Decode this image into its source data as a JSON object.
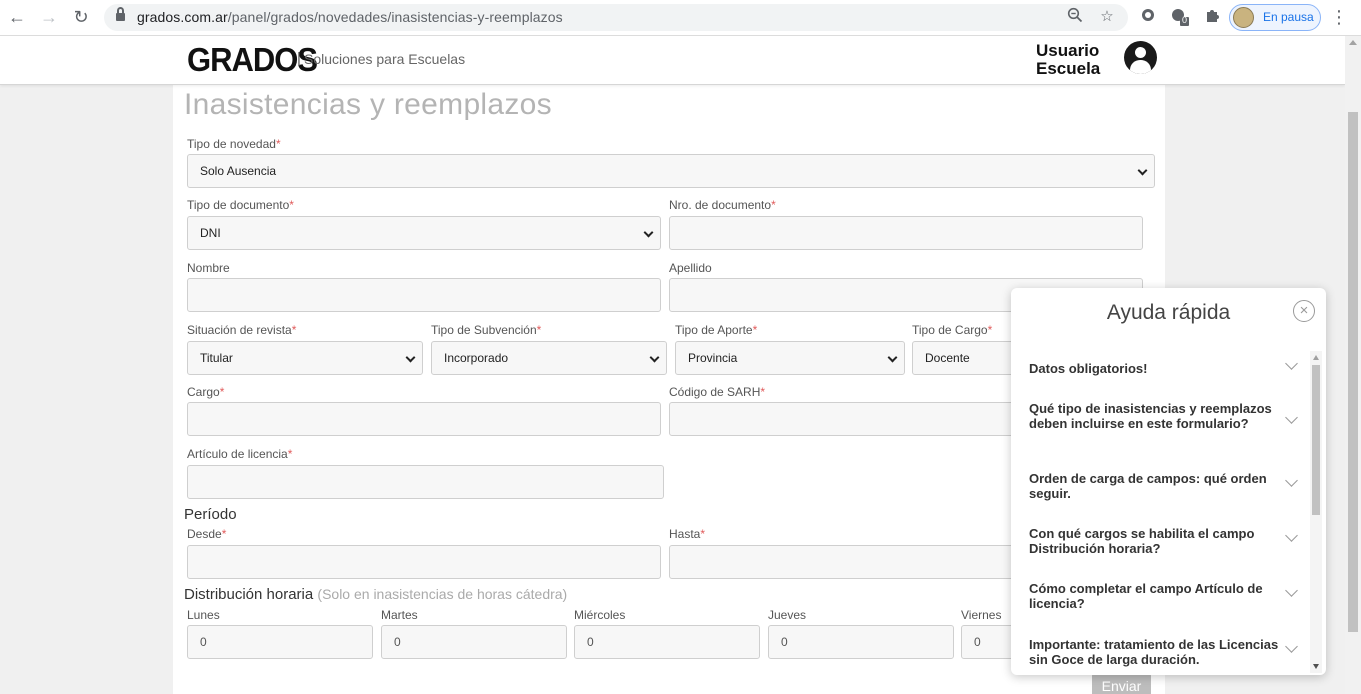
{
  "browser": {
    "url_host": "grados.com.ar",
    "url_path": "/panel/grados/novedades/inasistencias-y-reemplazos",
    "profile_label": "En pausa",
    "badge_count": "0"
  },
  "header": {
    "logo": "GRADOS",
    "separator": "|",
    "tagline": "Soluciones para Escuelas",
    "user_line1": "Usuario",
    "user_line2": "Escuela"
  },
  "form": {
    "title": "Inasistencias y reemplazos",
    "required_mark": "*",
    "tipo_novedad": {
      "label": "Tipo de novedad",
      "value": "Solo Ausencia"
    },
    "tipo_documento": {
      "label": "Tipo de documento",
      "value": "DNI"
    },
    "nro_documento": {
      "label": "Nro. de documento",
      "value": ""
    },
    "nombre": {
      "label": "Nombre",
      "value": ""
    },
    "apellido": {
      "label": "Apellido",
      "value": ""
    },
    "situacion_revista": {
      "label": "Situación de revista",
      "value": "Titular"
    },
    "tipo_subvencion": {
      "label": "Tipo de Subvención",
      "value": "Incorporado"
    },
    "tipo_aporte": {
      "label": "Tipo de Aporte",
      "value": "Provincia"
    },
    "tipo_cargo": {
      "label": "Tipo de Cargo",
      "value": "Docente"
    },
    "cargo": {
      "label": "Cargo",
      "value": ""
    },
    "codigo_sarh": {
      "label": "Código de SARH",
      "value": ""
    },
    "articulo_licencia": {
      "label": "Artículo de licencia",
      "value": ""
    },
    "periodo": {
      "title": "Período",
      "desde": {
        "label": "Desde",
        "value": ""
      },
      "hasta": {
        "label": "Hasta",
        "value": ""
      }
    },
    "distribucion": {
      "title": "Distribución horaria",
      "note": "(Solo en inasistencias de horas cátedra)",
      "days": [
        {
          "label": "Lunes",
          "value": "0"
        },
        {
          "label": "Martes",
          "value": "0"
        },
        {
          "label": "Miércoles",
          "value": "0"
        },
        {
          "label": "Jueves",
          "value": "0"
        },
        {
          "label": "Viernes",
          "value": "0"
        }
      ]
    },
    "submit_label": "Enviar"
  },
  "help": {
    "title": "Ayuda rápida",
    "close_glyph": "×",
    "items": [
      {
        "text": "Datos obligatorios!"
      },
      {
        "text": "Qué tipo de inasistencias y reemplazos deben incluirse en este formulario?"
      },
      {
        "text": "Orden de carga de campos: qué orden seguir."
      },
      {
        "text": "Con qué cargos se habilita el campo Distribución horaria?"
      },
      {
        "text": "Cómo completar el campo Artículo de licencia?"
      },
      {
        "text": "Importante: tratamiento de las Licencias sin Goce de larga duración."
      }
    ]
  }
}
